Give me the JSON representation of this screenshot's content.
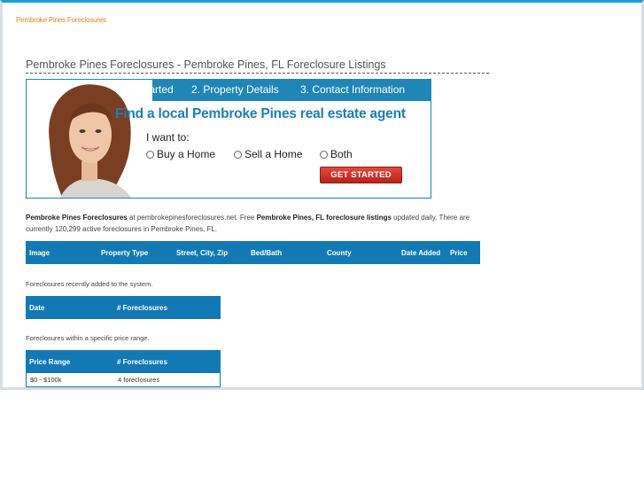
{
  "header": {
    "site_link": "Pembroke Pines Foreclosures"
  },
  "page": {
    "title": "Pembroke Pines Foreclosures - Pembroke Pines, FL Foreclosure Listings"
  },
  "banner": {
    "steps": [
      "1. Get Started",
      "2. Property Details",
      "3. Contact Information"
    ],
    "headline": "Find a local Pembroke Pines real estate agent",
    "prompt": "I want to:",
    "options": [
      "Buy a Home",
      "Sell a Home",
      "Both"
    ],
    "cta_label": "GET STARTED"
  },
  "intro": {
    "part1_bold": "Pembroke Pines Foreclosures",
    "part2": " at pembrokepinesforeclosures.net. Free ",
    "part3_bold": "Pembroke Pines, FL foreclosure listings",
    "part4": " updated daily. There are currently 120,299 active foreclosures in Pembroke Pines, FL."
  },
  "listings_table": {
    "columns": [
      "Image",
      "Property Type",
      "Street, City, Zip",
      "Bed/Bath",
      "County",
      "Date Added",
      "Price"
    ]
  },
  "recent": {
    "caption": "Foreclosures recently added to the system.",
    "columns": [
      "Date",
      "# Foreclosures"
    ]
  },
  "price_ranges": {
    "caption": "Foreclosures within a specific price range.",
    "columns": [
      "Price Range",
      "# Foreclosures"
    ],
    "rows": [
      {
        "range": "$0 - $100k",
        "count": "4 foreclosures"
      }
    ]
  },
  "colors": {
    "accent": "#1279b4",
    "link": "#e8811a",
    "cta": "#c8302a",
    "top_border": "#1aa0d8"
  }
}
